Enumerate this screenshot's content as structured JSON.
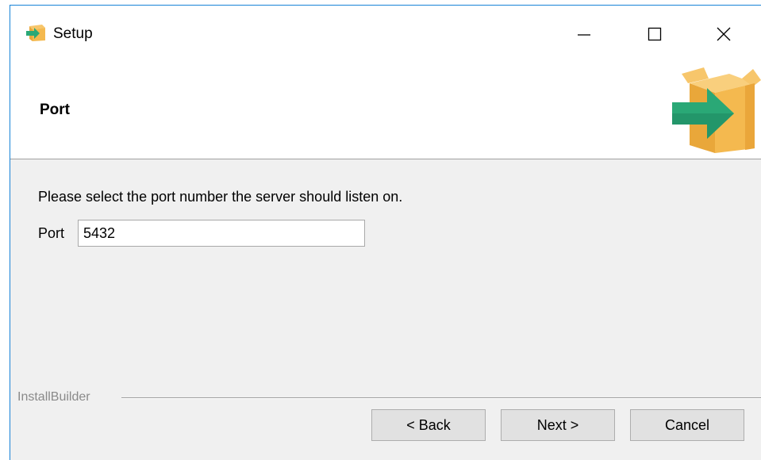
{
  "window": {
    "title": "Setup",
    "controls": {
      "minimize": "minimize",
      "maximize": "maximize",
      "close": "close"
    }
  },
  "header": {
    "page_title": "Port"
  },
  "content": {
    "instructions": "Please select the port number the server should listen on.",
    "port_label": "Port",
    "port_value": "5432"
  },
  "footer": {
    "brand": "InstallBuilder",
    "back_label": "< Back",
    "next_label": "Next >",
    "cancel_label": "Cancel"
  },
  "colors": {
    "window_border": "#1883d7",
    "box_orange": "#f4b94f",
    "arrow_green": "#2aa876"
  },
  "icons": {
    "app": "installer-box-icon",
    "header": "installer-box-arrow-icon"
  }
}
